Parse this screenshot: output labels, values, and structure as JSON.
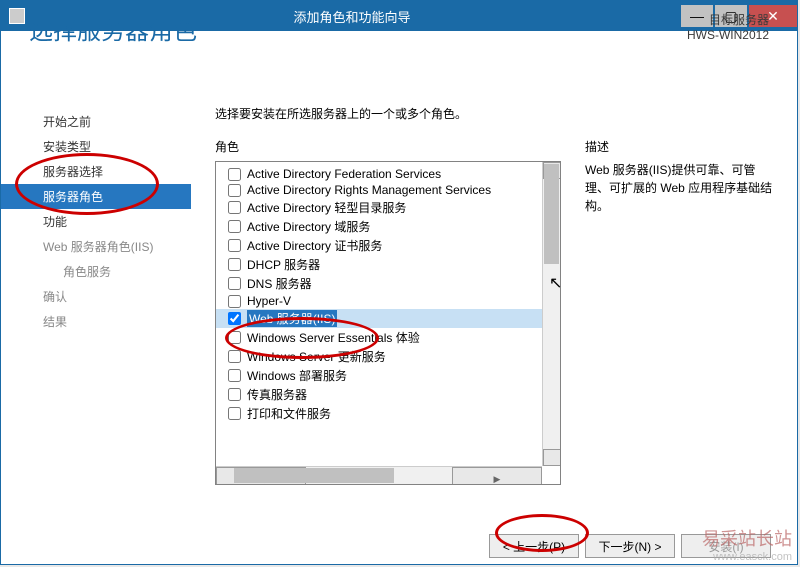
{
  "window_title": "添加角色和功能向导",
  "header_title": "选择服务器角色",
  "target_label": "目标服务器",
  "target_server": "HWS-WIN2012",
  "instruction": "选择要安装在所选服务器上的一个或多个角色。",
  "roles_label": "角色",
  "desc_label": "描述",
  "nav": {
    "0": "开始之前",
    "1": "安装类型",
    "2": "服务器选择",
    "3": "服务器角色",
    "4": "功能",
    "5": "Web 服务器角色(IIS)",
    "6": "角色服务",
    "7": "确认",
    "8": "结果"
  },
  "roles": {
    "0": "Active Directory Federation Services",
    "1": "Active Directory Rights Management Services",
    "2": "Active Directory 轻型目录服务",
    "3": "Active Directory 域服务",
    "4": "Active Directory 证书服务",
    "5": "DHCP 服务器",
    "6": "DNS 服务器",
    "7": "Hyper-V",
    "8": "Web 服务器(IIS)",
    "9": "Windows Server Essentials 体验",
    "10": "Windows Server 更新服务",
    "11": "Windows 部署服务",
    "12": "传真服务器",
    "13": "打印和文件服务"
  },
  "desc_text": "Web 服务器(IIS)提供可靠、可管理、可扩展的 Web 应用程序基础结构。",
  "buttons": {
    "prev": "< 上一步(P)",
    "next": "下一步(N) >",
    "install": "安装(I)"
  },
  "watermark1": "易采站长站",
  "watermark2": "www.easck.com"
}
